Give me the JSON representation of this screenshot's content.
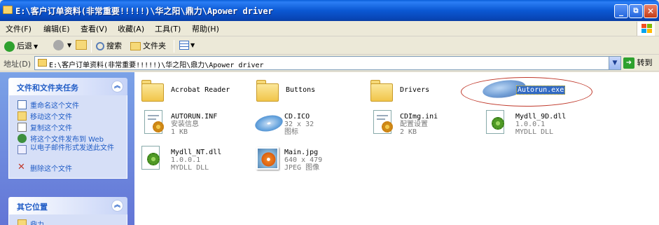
{
  "window": {
    "title": "E:\\客户订单资料(非常重要!!!!!)\\华之阳\\鼎力\\Apower driver",
    "buttons": [
      "minimize",
      "maximize",
      "close"
    ],
    "minimize_glyph": "_",
    "maximize_glyph": "⧉",
    "close_glyph": "✕"
  },
  "menubar": {
    "items": [
      "文件(F)",
      "编辑(E)",
      "查看(V)",
      "收藏(A)",
      "工具(T)",
      "帮助(H)"
    ]
  },
  "toolbar": {
    "back_label": "后退",
    "search_label": "搜索",
    "folders_label": "文件夹",
    "caret": "▼"
  },
  "address": {
    "label": "地址(D)",
    "value": "E:\\客户订单资料(非常重要!!!!!)\\华之阳\\鼎力\\Apower driver",
    "go_label": "转到",
    "go_glyph": "➜",
    "dropdown_glyph": "▼"
  },
  "sidebar": {
    "file_tasks": {
      "title": "文件和文件夹任务",
      "collapse_glyph": "︽",
      "items": [
        {
          "label": "重命名这个文件",
          "icon": "rename-icon"
        },
        {
          "label": "移动这个文件",
          "icon": "move-icon"
        },
        {
          "label": "复制这个文件",
          "icon": "copy-icon"
        },
        {
          "label": "将这个文件发布到 Web",
          "icon": "web-publish-icon"
        },
        {
          "label": "以电子邮件形式发送此文件",
          "icon": "email-icon"
        },
        {
          "label": "删除这个文件",
          "icon": "delete-icon"
        }
      ]
    },
    "other_places": {
      "title": "其它位置",
      "collapse_glyph": "︽",
      "items": [
        {
          "label": "鼎力",
          "icon": "folder-icon"
        }
      ]
    }
  },
  "files": [
    {
      "name": "Acrobat Reader",
      "type": "folder"
    },
    {
      "name": "Buttons",
      "type": "folder"
    },
    {
      "name": "Drivers",
      "type": "folder"
    },
    {
      "name": "Autorun.exe",
      "type": "exe",
      "selected": true
    },
    {
      "name": "AUTORUN.INF",
      "line2": "安装信息",
      "line3": "1 KB",
      "type": "inf"
    },
    {
      "name": "CD.ICO",
      "line2": "32 x 32",
      "line3": "图标",
      "type": "ico"
    },
    {
      "name": "CDImg.ini",
      "line2": "配置设置",
      "line3": "2 KB",
      "type": "ini"
    },
    {
      "name": "Mydll_9D.dll",
      "line2": "1.0.0.1",
      "line3": "MYDLL DLL",
      "type": "dll"
    },
    {
      "name": "Mydll_NT.dll",
      "line2": "1.0.0.1",
      "line3": "MYDLL DLL",
      "type": "dll"
    },
    {
      "name": "Main.jpg",
      "line2": "640 x 479",
      "line3": "JPEG 图像",
      "type": "jpg"
    }
  ],
  "colors": {
    "titlebar": "#0a5fd8",
    "sidebar_gradient": "#7ba2e7",
    "selection": "#316ac5",
    "annotation_ellipse": "#c0392b"
  }
}
